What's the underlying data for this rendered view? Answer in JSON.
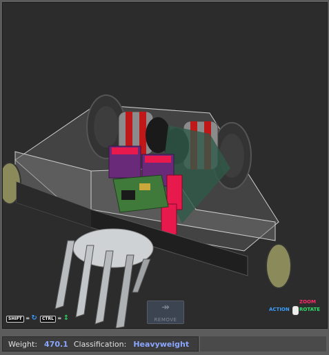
{
  "hints": {
    "shift_key": "SHIFT",
    "ctrl_key": "CTRL",
    "equals": "="
  },
  "toolbar": {
    "remove_label": "REMOVE"
  },
  "camera_legend": {
    "zoom": "ZOOM",
    "action": "ACTION",
    "rotate": "ROTATE",
    "zoom_color": "#ff2a6a",
    "action_color": "#3aa0ff",
    "rotate_color": "#2ee06a"
  },
  "status": {
    "weight_label": "Weight:",
    "weight_value": "470.1",
    "class_label": "Classification:",
    "class_value": "Heavyweight"
  }
}
